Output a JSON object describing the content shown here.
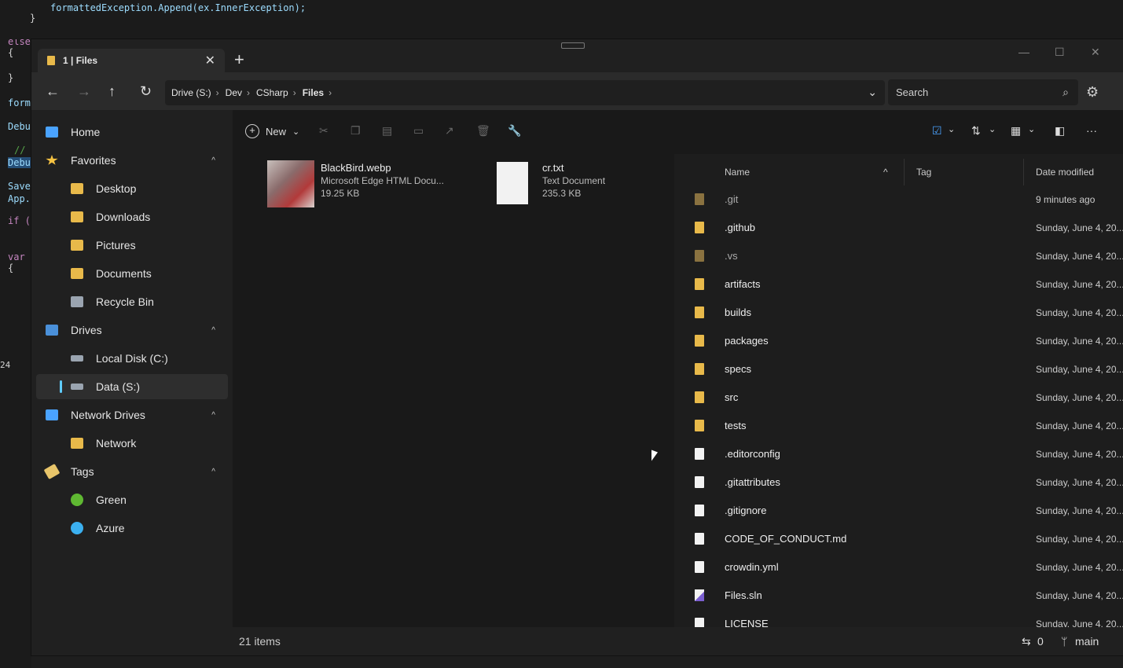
{
  "ide": {
    "line1": "formattedException.Append(ex.InnerException);",
    "line_brace": "}",
    "left_snippets": [
      "}",
      "else",
      "{",
      "}",
      "form",
      "Debu",
      "//",
      "Debu",
      "Save",
      "App.",
      "if (",
      "var",
      "{",
      "24"
    ]
  },
  "window": {
    "tab_label": "1 | Files",
    "tab_close": "✕",
    "new_tab": "+",
    "controls": [
      "—",
      "☐",
      "✕"
    ]
  },
  "nav": {
    "back": "←",
    "forward": "→",
    "up": "↑",
    "refresh": "↻",
    "breadcrumbs": [
      "Drive (S:)",
      "Dev",
      "CSharp",
      "Files"
    ],
    "search_placeholder": "Search"
  },
  "sidebar": {
    "items": [
      {
        "label": "Home",
        "icon": "home-icon",
        "color": "#4aa3ff"
      },
      {
        "label": "Favorites",
        "icon": "star-icon",
        "color": "#f5c242"
      },
      {
        "label": "Desktop",
        "icon": "desktop-folder-icon",
        "color": "#e8b94a"
      },
      {
        "label": "Downloads",
        "icon": "downloads-folder-icon",
        "color": "#e8b94a"
      },
      {
        "label": "Pictures",
        "icon": "pictures-folder-icon",
        "color": "#e8b94a"
      },
      {
        "label": "Documents",
        "icon": "documents-folder-icon",
        "color": "#e8b94a"
      },
      {
        "label": "Recycle Bin",
        "icon": "recycle-bin-icon",
        "color": "#9aa4b0"
      },
      {
        "label": "Drives",
        "icon": "drives-icon",
        "color": "#4a90d9"
      },
      {
        "label": "Local Disk (C:)",
        "icon": "disk-icon",
        "color": "#9aa4b0"
      },
      {
        "label": "Data (S:)",
        "icon": "disk-icon",
        "color": "#9aa4b0"
      },
      {
        "label": "Network Drives",
        "icon": "network-drives-icon",
        "color": "#4aa3ff"
      },
      {
        "label": "Network",
        "icon": "network-folder-icon",
        "color": "#e8b94a"
      },
      {
        "label": "Tags",
        "icon": "tag-icon",
        "color": "#e8c56a"
      },
      {
        "label": "Green",
        "icon": "green-tag-dot",
        "color": "#5fb832"
      },
      {
        "label": "Azure",
        "icon": "azure-tag-dot",
        "color": "#3bb0f0"
      }
    ]
  },
  "commands": {
    "new_label": "New"
  },
  "preview": {
    "cards": [
      {
        "name": "BlackBird.webp",
        "type": "Microsoft Edge HTML Docu...",
        "size": "19.25 KB"
      },
      {
        "name": "cr.txt",
        "type": "Text Document",
        "size": "235.3 KB"
      }
    ]
  },
  "list": {
    "columns": [
      "Name",
      "Tag",
      "Date modified"
    ],
    "rows": [
      {
        "name": ".git",
        "kind": "folder-dim",
        "date": "9 minutes ago"
      },
      {
        "name": ".github",
        "kind": "folder",
        "date": "Sunday, June 4, 20..."
      },
      {
        "name": ".vs",
        "kind": "folder-dim",
        "date": "Sunday, June 4, 20..."
      },
      {
        "name": "artifacts",
        "kind": "folder",
        "date": "Sunday, June 4, 20..."
      },
      {
        "name": "builds",
        "kind": "folder",
        "date": "Sunday, June 4, 20..."
      },
      {
        "name": "packages",
        "kind": "folder",
        "date": "Sunday, June 4, 20..."
      },
      {
        "name": "specs",
        "kind": "folder",
        "date": "Sunday, June 4, 20..."
      },
      {
        "name": "src",
        "kind": "folder",
        "date": "Sunday, June 4, 20..."
      },
      {
        "name": "tests",
        "kind": "folder",
        "date": "Sunday, June 4, 20..."
      },
      {
        "name": ".editorconfig",
        "kind": "file",
        "date": "Sunday, June 4, 20..."
      },
      {
        "name": ".gitattributes",
        "kind": "file",
        "date": "Sunday, June 4, 20..."
      },
      {
        "name": ".gitignore",
        "kind": "file",
        "date": "Sunday, June 4, 20..."
      },
      {
        "name": "CODE_OF_CONDUCT.md",
        "kind": "file",
        "date": "Sunday, June 4, 20..."
      },
      {
        "name": "crowdin.yml",
        "kind": "file",
        "date": "Sunday, June 4, 20..."
      },
      {
        "name": "Files.sln",
        "kind": "sln",
        "date": "Sunday, June 4, 20..."
      },
      {
        "name": "LICENSE",
        "kind": "file",
        "date": "Sunday, June 4, 20..."
      }
    ]
  },
  "status": {
    "items_count": "21 items",
    "sync_count": "0",
    "branch": "main"
  },
  "colors": {
    "accent": "#60cdff",
    "folder": "#e8b94a"
  }
}
